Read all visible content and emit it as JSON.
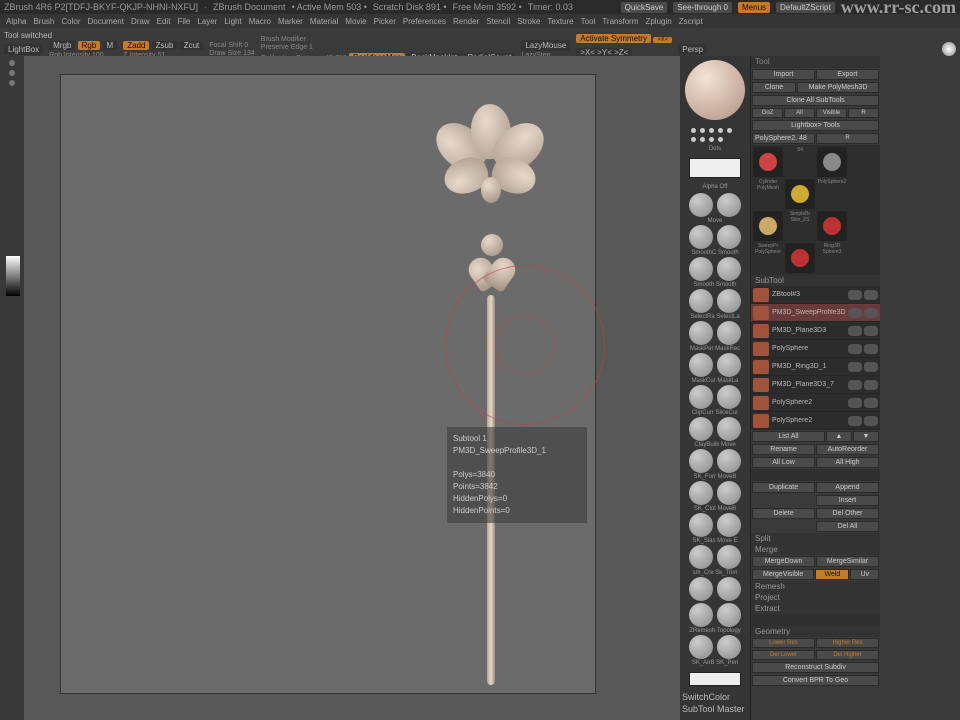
{
  "title": {
    "app": "ZBrush 4R6 P2[TDFJ-BKYF-QKJP-NHNI-NXFU]",
    "doc": "ZBrush Document",
    "mem": "• Active Mem 503 •",
    "scratch": "Scratch Disk 891 •",
    "free": "Free Mem 3592 •",
    "timer": "Timer: 0.03",
    "quicksave": "QuickSave",
    "seethrough": "See-through  0",
    "menus": "Menus",
    "zscript": "DefaultZScript",
    "url": "www.rr-sc.com"
  },
  "menus": [
    "Alpha",
    "Brush",
    "Color",
    "Document",
    "Draw",
    "Edit",
    "File",
    "Layer",
    "Light",
    "Macro",
    "Marker",
    "Material",
    "Movie",
    "Picker",
    "Preferences",
    "Render",
    "Stencil",
    "Stroke",
    "Texture",
    "Tool",
    "Transform",
    "Zplugin",
    "Zscript"
  ],
  "status": "Tool switched",
  "opt": {
    "lightbox": "LightBox",
    "mrgb": "Mrgb",
    "rgb": "Rgb",
    "m": "M",
    "rgbint": "Rgb Intensity 100",
    "zadd": "Zadd",
    "zsub": "Zsub",
    "zcut": "Zcut",
    "zint": "Z Intensity 51",
    "focal": "Focal Shift 0",
    "draw": "Draw Size 134",
    "brushmod": "Brush Modifier",
    "preserve": "Preserve Edge 1",
    "calib": "Calibration Distance 45.719",
    "backface": "BackfaceMas",
    "backmask": "BackMaskInt",
    "radialcount": "RadialCount",
    "lazy": "LazyMouse",
    "lazystep": "LazyStep",
    "activate": "Activate Symmetry",
    "xyz": ">X< >Y< >Z<",
    "r": "(R)",
    "persp": "Persp"
  },
  "tool": {
    "label": "Tool",
    "import": "Import",
    "export": "Export",
    "clone": "Clone",
    "make": "Make PolyMesh3D",
    "cloneall": "Clone All SubTools",
    "goz": "GoZ",
    "all": "All",
    "visible": "Visible",
    "r": "R",
    "lightbox": "Lightbox> Tools",
    "polysphere": "PolySphere2. 48"
  },
  "thumbs": [
    {
      "name": "S4",
      "color": "#c44"
    },
    {
      "name": "Cylinder PolyMesh",
      "color": "#888"
    },
    {
      "name": "PolySphere2",
      "color": "#ca3"
    },
    {
      "name": "SimpleBr Skin_ZS",
      "color": "#ca6"
    },
    {
      "name": "SweepPr PolySphere",
      "color": "#b33"
    },
    {
      "name": "Ring3D Sphere3",
      "color": "#b33"
    }
  ],
  "subtool_label": "SubTool",
  "sublist": [
    {
      "name": "ZBtool#3"
    },
    {
      "name": "PM3D_SweepProfile3D_1",
      "sel": true
    },
    {
      "name": "PM3D_Plane3D3"
    },
    {
      "name": "PolySphere"
    },
    {
      "name": "PM3D_Ring3D_1"
    },
    {
      "name": "PM3D_Plane3D3_7"
    },
    {
      "name": "PolySphere2"
    },
    {
      "name": "PolySphere2"
    }
  ],
  "subbtns": {
    "listall": "List All",
    "rename": "Rename",
    "autoreorder": "AutoReorder",
    "alllow": "All Low",
    "allhigh": "All High",
    "dup": "Duplicate",
    "append": "Append",
    "insert": "Insert",
    "delete": "Delete",
    "delother": "Del Other",
    "delall": "Del All",
    "split": "Split",
    "merge": "Merge",
    "mergedown": "MergeDown",
    "mergesimilar": "MergeSimilar",
    "mergevisible": "MergeVisible",
    "weld": "Weld",
    "uv": "Uv",
    "remesh": "Remesh",
    "project": "Project",
    "extract": "Extract",
    "geometry": "Geometry",
    "reconstruct": "Reconstruct Subdiv",
    "convertbpr": "Convert BPR To Geo"
  },
  "brushlabels": [
    "Move",
    "SmoothC Smooth",
    "Smooth Smooth",
    "SelectRa SelectLa",
    "MaskPer MaskRec",
    "MaskCur MaskLa",
    "ClipCurr SliceCur",
    "ClayBuilk Move",
    "SK_Forr MoveB",
    "SK_Clot MoveB",
    "SK_Slas Move E",
    "sm_Cre Sk_Trim",
    "",
    "ZRemesh Topology",
    "SK_AirB SK_Pen"
  ],
  "switchcolor": "SwitchColor",
  "subtoolmaster": "SubTool Master",
  "info": {
    "t1": "Subtool 1",
    "t2": "PM3D_SweepProfile3D_1",
    "p1": "Polys=3840",
    "p2": "Points=3842",
    "p3": "HiddenPolys=0",
    "p4": "HiddenPoints=0"
  }
}
